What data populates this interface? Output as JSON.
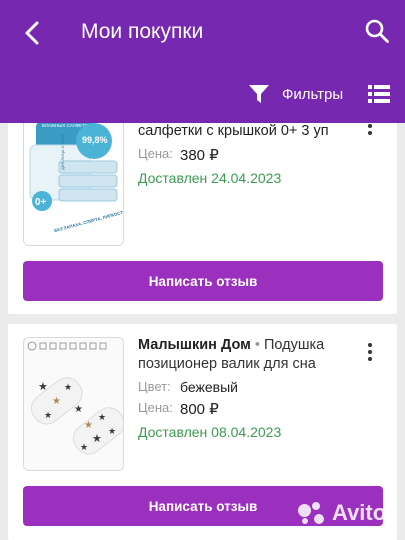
{
  "header": {
    "title": "Мои покупки",
    "filter_label": "Фильтры",
    "back_icon": "chevron-left-icon",
    "search_icon": "search-icon",
    "filter_icon": "funnel-icon",
    "view_icon": "list-view-icon"
  },
  "orders": [
    {
      "title_visible": "салфетки с крышкой 0+ 3 уп",
      "price_label": "Цена:",
      "price": "380 ₽",
      "status": "Доставлен 24.04.2023",
      "review_label": "Написать отзыв",
      "image_texts": {
        "percent": "99,8%",
        "age": "0+",
        "desc": "БЕЗ ЗАПАХА, СПИРТА, ЛИПКОСТИ И ПАРАБЕНОВ",
        "top": "ВЛАЖНЫХ САЛФЕТОК",
        "side": "ДЛЯ ЛИЦА И ТЕЛА"
      }
    },
    {
      "brand": "Малышкин Дом",
      "separator": "•",
      "name": "Подушка позиционер валик для сна",
      "color_label": "Цвет:",
      "color": "бежевый",
      "price_label": "Цена:",
      "price": "800 ₽",
      "status": "Доставлен 08.04.2023",
      "review_label": "Написать отзыв"
    }
  ],
  "watermark": "Avito",
  "colors": {
    "header_bg": "#7629b0",
    "button_bg": "#9b2fbe",
    "status_green": "#3c9a52"
  }
}
